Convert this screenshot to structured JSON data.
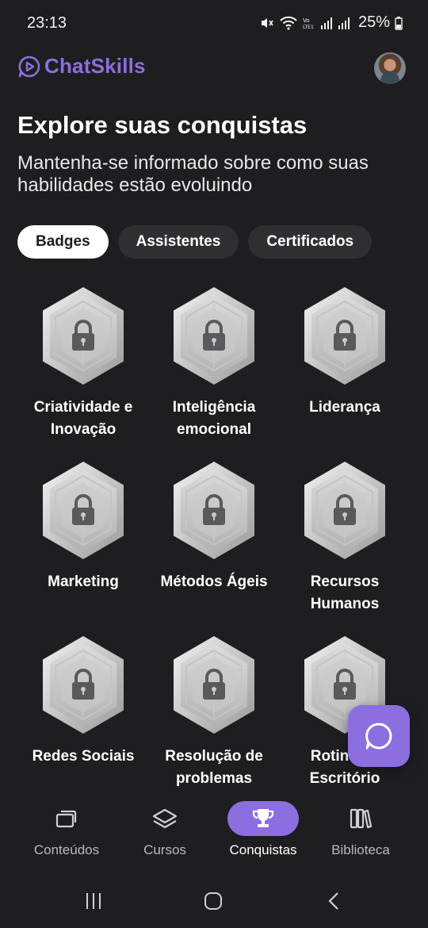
{
  "status_bar": {
    "time": "23:13",
    "battery": "25%",
    "icons": [
      "mute-icon",
      "wifi-icon",
      "volte-icon",
      "signal-icon",
      "signal-icon",
      "battery-icon"
    ]
  },
  "header": {
    "app_name": "ChatSkills",
    "logo_icon": "play-chat-icon",
    "brand_color": "#8b6fe0"
  },
  "page": {
    "title": "Explore suas conquistas",
    "subtitle": "Mantenha-se informado sobre como suas habilidades estão evoluindo"
  },
  "tabs": [
    {
      "label": "Badges",
      "active": true
    },
    {
      "label": "Assistentes",
      "active": false
    },
    {
      "label": "Certificados",
      "active": false
    }
  ],
  "badges": [
    {
      "label_line1": "Criatividade e",
      "label_line2": "Inovação",
      "locked": true
    },
    {
      "label_line1": "Inteligência",
      "label_line2": "emocional",
      "locked": true
    },
    {
      "label_line1": "Liderança",
      "label_line2": "",
      "locked": true
    },
    {
      "label_line1": "Marketing",
      "label_line2": "",
      "locked": true
    },
    {
      "label_line1": "Métodos Ágeis",
      "label_line2": "",
      "locked": true
    },
    {
      "label_line1": "Recursos",
      "label_line2": "Humanos",
      "locked": true
    },
    {
      "label_line1": "Redes Sociais",
      "label_line2": "",
      "locked": true
    },
    {
      "label_line1": "Resolução de",
      "label_line2": "problemas",
      "locked": true
    },
    {
      "label_line1": "Rotina de",
      "label_line2": "Escritório",
      "locked": true
    }
  ],
  "chat_fab": {
    "icon": "chat-bubble-icon"
  },
  "bottom_nav": [
    {
      "label": "Conteúdos",
      "icon": "stacked-cards-icon",
      "active": false
    },
    {
      "label": "Cursos",
      "icon": "layers-icon",
      "active": false
    },
    {
      "label": "Conquistas",
      "icon": "trophy-icon",
      "active": true
    },
    {
      "label": "Biblioteca",
      "icon": "books-icon",
      "active": false
    }
  ],
  "system_nav": [
    "recent-apps-icon",
    "home-icon",
    "back-icon"
  ]
}
